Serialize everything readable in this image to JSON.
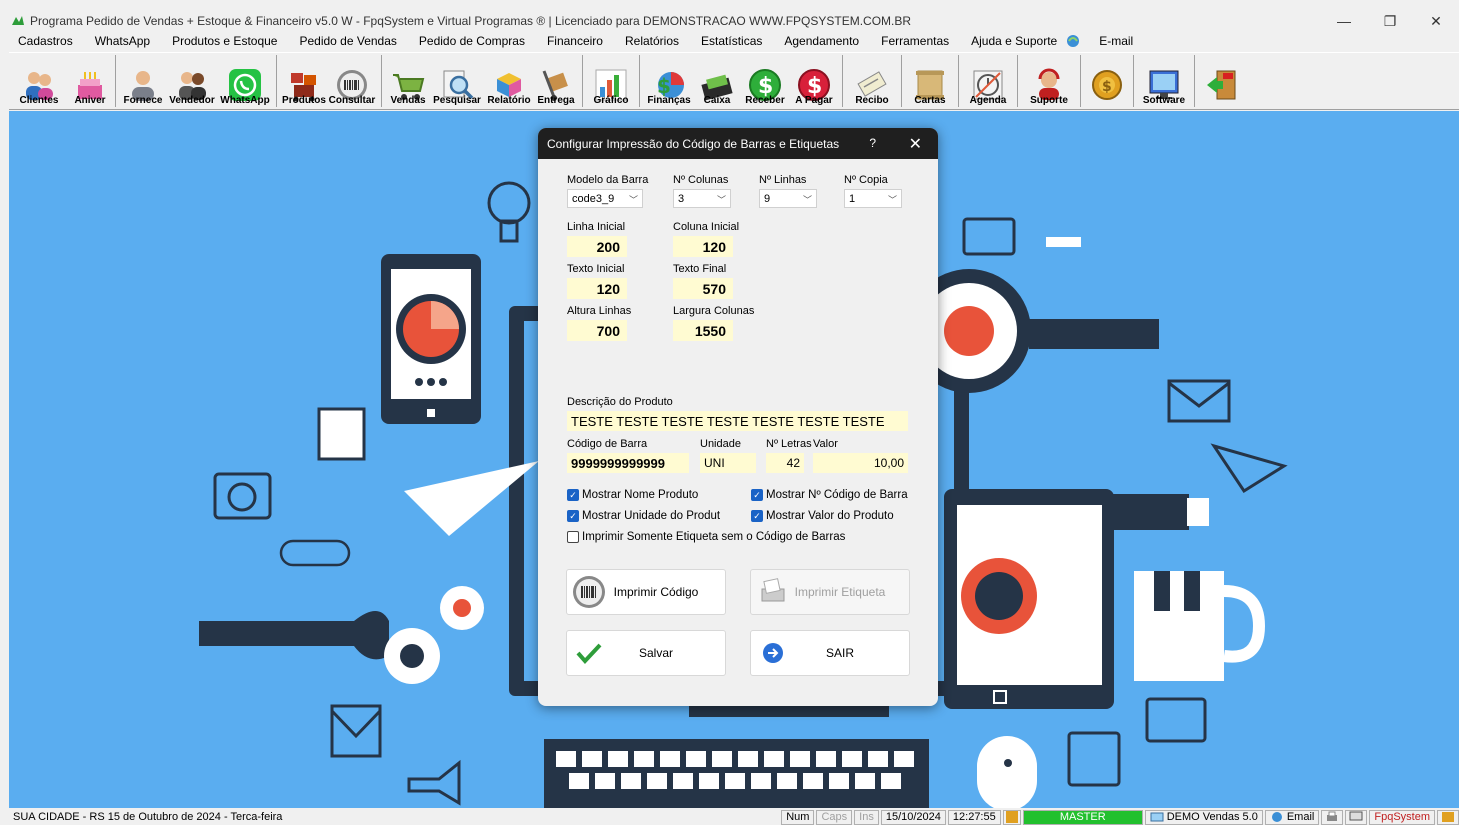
{
  "window": {
    "title": "Programa Pedido de Vendas + Estoque & Financeiro v5.0 W - FpqSystem e Virtual Programas ® | Licenciado para  DEMONSTRACAO WWW.FPQSYSTEM.COM.BR",
    "minimize": "—",
    "restore": "❐",
    "close": "✕"
  },
  "menu": {
    "items": [
      "Cadastros",
      "WhatsApp",
      "Produtos e Estoque",
      "Pedido de Vendas",
      "Pedido de Compras",
      "Financeiro",
      "Relatórios",
      "Estatísticas",
      "Agendamento",
      "Ferramentas",
      "Ajuda e Suporte"
    ],
    "email": "E-mail"
  },
  "toolbar": {
    "buttons": [
      {
        "label": "Clientes",
        "icon": "people-icon"
      },
      {
        "label": "Aniver",
        "icon": "cake-icon"
      },
      {
        "label": "Fornece",
        "icon": "person-icon"
      },
      {
        "label": "Vendedor",
        "icon": "users-icon"
      },
      {
        "label": "WhatsApp",
        "icon": "whatsapp-icon"
      },
      {
        "label": "Produtos",
        "icon": "boxes-icon"
      },
      {
        "label": "Consultar",
        "icon": "barcode-icon"
      },
      {
        "label": "Vendas",
        "icon": "cart-icon"
      },
      {
        "label": "Pesquisar",
        "icon": "magnifier-icon"
      },
      {
        "label": "Relatório",
        "icon": "report-icon"
      },
      {
        "label": "Entrega",
        "icon": "dolly-icon"
      },
      {
        "label": "Gráfico",
        "icon": "chart-icon"
      },
      {
        "label": "Finanças",
        "icon": "finance-icon"
      },
      {
        "label": "Caixa",
        "icon": "cashbox-icon"
      },
      {
        "label": "Receber",
        "icon": "receive-icon"
      },
      {
        "label": "A Pagar",
        "icon": "pay-icon"
      },
      {
        "label": "Recibo",
        "icon": "receipt-icon"
      },
      {
        "label": "Cartas",
        "icon": "letter-icon"
      },
      {
        "label": "Agenda",
        "icon": "agenda-icon"
      },
      {
        "label": "Suporte",
        "icon": "support-icon"
      },
      {
        "label": "",
        "icon": "coins-icon"
      },
      {
        "label": "Software",
        "icon": "software-icon"
      },
      {
        "label": "",
        "icon": "exit-icon"
      }
    ]
  },
  "dialog": {
    "title": "Configurar Impressão do Código de Barras e Etiquetas",
    "help": "?",
    "close": "✕",
    "modelo_label": "Modelo da Barra",
    "modelo_value": "code3_9",
    "colunas_label": "Nº Colunas",
    "colunas_value": "3",
    "linhas_label": "Nº Linhas",
    "linhas_value": "9",
    "copia_label": "Nº Copia",
    "copia_value": "1",
    "linha_inicial_label": "Linha Inicial",
    "linha_inicial_value": "200",
    "coluna_inicial_label": "Coluna Inicial",
    "coluna_inicial_value": "120",
    "texto_inicial_label": "Texto Inicial",
    "texto_inicial_value": "120",
    "texto_final_label": "Texto Final",
    "texto_final_value": "570",
    "altura_label": "Altura Linhas",
    "altura_value": "700",
    "largura_label": "Largura Colunas",
    "largura_value": "1550",
    "descricao_label": "Descrição do Produto",
    "descricao_value": "TESTE TESTE TESTE TESTE TESTE TESTE TESTE",
    "codigo_label": "Código de Barra",
    "codigo_value": "9999999999999",
    "unidade_label": "Unidade",
    "unidade_value": "UNI",
    "letras_label": "Nº Letras",
    "letras_value": "42",
    "valor_label": "Valor",
    "valor_value": "10,00",
    "chk_nome": "Mostrar Nome Produto",
    "chk_codigo": "Mostrar Nº Código de Barra",
    "chk_unidade": "Mostrar Unidade do Produt",
    "chk_valor": "Mostrar Valor do Produto",
    "chk_somente": "Imprimir Somente Etiqueta sem o Código de Barras",
    "btn_imprimir_codigo": "Imprimir Código",
    "btn_imprimir_etiqueta": "Imprimir Etiqueta",
    "btn_salvar": "Salvar",
    "btn_sair": "SAIR"
  },
  "status": {
    "location": "SUA CIDADE - RS 15 de Outubro de 2024 - Terca-feira",
    "num": "Num",
    "caps": "Caps",
    "ins": "Ins",
    "date": "15/10/2024",
    "time": "12:27:55",
    "user": "MASTER",
    "version": "DEMO Vendas 5.0",
    "email": "Email",
    "brand": "FpqSystem"
  }
}
